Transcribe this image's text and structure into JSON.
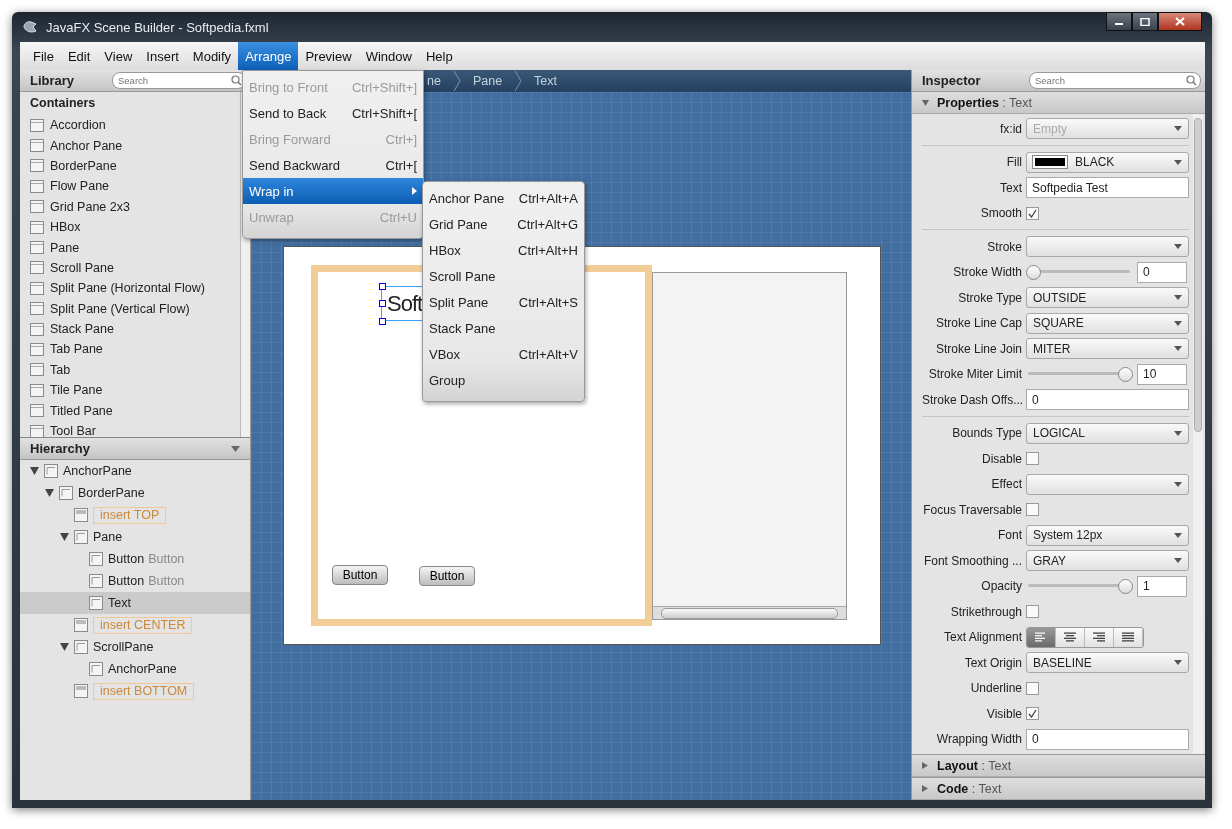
{
  "window": {
    "title": "JavaFX Scene Builder - Softpedia.fxml"
  },
  "menubar": [
    {
      "label": "File",
      "selected": false
    },
    {
      "label": "Edit",
      "selected": false
    },
    {
      "label": "View",
      "selected": false
    },
    {
      "label": "Insert",
      "selected": false
    },
    {
      "label": "Modify",
      "selected": false
    },
    {
      "label": "Arrange",
      "selected": true
    },
    {
      "label": "Preview",
      "selected": false
    },
    {
      "label": "Window",
      "selected": false
    },
    {
      "label": "Help",
      "selected": false
    }
  ],
  "arrange_menu": {
    "items": [
      {
        "label": "Bring to Front",
        "shortcut": "Ctrl+Shift+]",
        "disabled": true,
        "selected": false
      },
      {
        "label": "Send to Back",
        "shortcut": "Ctrl+Shift+[",
        "disabled": false,
        "selected": false
      },
      {
        "label": "Bring Forward",
        "shortcut": "Ctrl+]",
        "disabled": true,
        "selected": false
      },
      {
        "label": "Send Backward",
        "shortcut": "Ctrl+[",
        "disabled": false,
        "selected": false
      },
      {
        "label": "Wrap in",
        "disabled": false,
        "selected": true,
        "submenu": true
      },
      {
        "label": "Unwrap",
        "shortcut": "Ctrl+U",
        "disabled": true,
        "selected": false
      }
    ]
  },
  "wrap_submenu": {
    "items": [
      {
        "label": "Anchor Pane",
        "shortcut": "Ctrl+Alt+A"
      },
      {
        "label": "Grid Pane",
        "shortcut": "Ctrl+Alt+G"
      },
      {
        "label": "HBox",
        "shortcut": "Ctrl+Alt+H"
      },
      {
        "label": "Scroll Pane"
      },
      {
        "label": "Split Pane",
        "shortcut": "Ctrl+Alt+S"
      },
      {
        "label": "Stack Pane"
      },
      {
        "label": "VBox",
        "shortcut": "Ctrl+Alt+V"
      },
      {
        "label": "Group"
      }
    ]
  },
  "library": {
    "title": "Library",
    "search": {
      "placeholder": "Search"
    },
    "section": "Containers",
    "items": [
      "Accordion",
      "Anchor Pane",
      "BorderPane",
      "Flow Pane",
      "Grid Pane 2x3",
      "HBox",
      "Pane",
      "Scroll Pane",
      "Split Pane (Horizontal Flow)",
      "Split Pane (Vertical Flow)",
      "Stack Pane",
      "Tab Pane",
      "Tab",
      "Tile Pane",
      "Titled Pane",
      "Tool Bar"
    ]
  },
  "hierarchy": {
    "title": "Hierarchy",
    "items": [
      {
        "kind": "node",
        "label": "AnchorPane",
        "selected": false,
        "expanded": true,
        "children": [
          {
            "kind": "node",
            "label": "BorderPane",
            "selected": false,
            "expanded": true,
            "children": [
              {
                "kind": "slot",
                "label": "insert TOP",
                "selected": false
              },
              {
                "kind": "node",
                "label": "Pane",
                "selected": false,
                "expanded": true,
                "children": [
                  {
                    "kind": "node",
                    "label": "Button",
                    "detail": "Button",
                    "selected": false
                  },
                  {
                    "kind": "node",
                    "label": "Button",
                    "detail": "Button",
                    "selected": false
                  },
                  {
                    "kind": "node",
                    "label": "Text",
                    "selected": true
                  }
                ]
              },
              {
                "kind": "slot",
                "label": "insert CENTER",
                "selected": false
              },
              {
                "kind": "node",
                "label": "ScrollPane",
                "selected": false,
                "expanded": true,
                "children": [
                  {
                    "kind": "node",
                    "label": "AnchorPane",
                    "selected": false
                  }
                ]
              },
              {
                "kind": "slot",
                "label": "insert BOTTOM",
                "selected": false
              }
            ]
          }
        ]
      }
    ]
  },
  "breadcrumb": [
    "ne",
    "Pane",
    "Text"
  ],
  "canvas": {
    "text": "Soft",
    "buttons": [
      "Button",
      "Button"
    ]
  },
  "inspector": {
    "title": "Inspector",
    "search": {
      "placeholder": "Search"
    },
    "sections": [
      {
        "title": "Properties",
        "subject": ": Text",
        "expanded": true
      },
      {
        "title": "Layout",
        "subject": ": Text",
        "expanded": false
      },
      {
        "title": "Code",
        "subject": ": Text",
        "expanded": false
      }
    ],
    "properties": [
      {
        "kind": "combo",
        "label": "fx:id",
        "placeholder": "Empty"
      },
      {
        "kind": "separator"
      },
      {
        "kind": "color",
        "label": "Fill",
        "value": "BLACK",
        "color": "#000000"
      },
      {
        "kind": "text",
        "label": "Text",
        "value": "Softpedia Test"
      },
      {
        "kind": "check",
        "label": "Smooth",
        "checked": true
      },
      {
        "kind": "separator"
      },
      {
        "kind": "combo",
        "label": "Stroke"
      },
      {
        "kind": "slider",
        "label": "Stroke Width",
        "level": 0,
        "value": "0"
      },
      {
        "kind": "combo",
        "label": "Stroke Type",
        "value": "OUTSIDE"
      },
      {
        "kind": "combo",
        "label": "Stroke Line Cap",
        "value": "SQUARE"
      },
      {
        "kind": "combo",
        "label": "Stroke Line Join",
        "value": "MITER"
      },
      {
        "kind": "slider",
        "label": "Stroke Miter Limit",
        "level": 1,
        "value": "10"
      },
      {
        "kind": "text",
        "label": "Stroke Dash Offs...",
        "value": "0"
      },
      {
        "kind": "separator"
      },
      {
        "kind": "combo",
        "label": "Bounds Type",
        "value": "LOGICAL"
      },
      {
        "kind": "check",
        "label": "Disable",
        "checked": false
      },
      {
        "kind": "combo",
        "label": "Effect"
      },
      {
        "kind": "check",
        "label": "Focus Traversable",
        "checked": false
      },
      {
        "kind": "combo",
        "label": "Font",
        "value": "System 12px"
      },
      {
        "kind": "combo",
        "label": "Font Smoothing ...",
        "value": "GRAY"
      },
      {
        "kind": "slider",
        "label": "Opacity",
        "level": 1,
        "value": "1"
      },
      {
        "kind": "check",
        "label": "Strikethrough",
        "checked": false
      },
      {
        "kind": "align",
        "label": "Text Alignment",
        "options": [
          {
            "kind": "left",
            "selected": true
          },
          {
            "kind": "center",
            "selected": false
          },
          {
            "kind": "right",
            "selected": false
          },
          {
            "kind": "justify",
            "selected": false
          }
        ]
      },
      {
        "kind": "combo",
        "label": "Text Origin",
        "value": "BASELINE"
      },
      {
        "kind": "check",
        "label": "Underline",
        "checked": false
      },
      {
        "kind": "check",
        "label": "Visible",
        "checked": true
      },
      {
        "kind": "text",
        "label": "Wrapping Width",
        "value": "0"
      }
    ]
  }
}
